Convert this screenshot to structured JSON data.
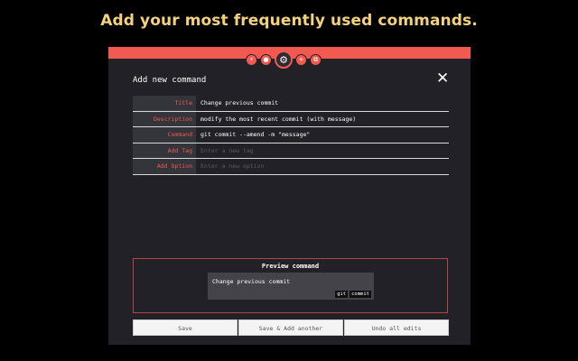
{
  "headline": "Add your most frequently used commands.",
  "colors": {
    "accent": "#f25a51",
    "headline": "#f3d27a",
    "panel": "#212127"
  },
  "nav_icons": [
    "bolt-icon",
    "location-pin-icon",
    "gear-icon",
    "plus-icon",
    "external-link-icon"
  ],
  "panel": {
    "title": "Add new command",
    "close_icon": "close-icon"
  },
  "form": {
    "rows": [
      {
        "label": "Title",
        "value": "Change previous commit",
        "placeholder": ""
      },
      {
        "label": "Description",
        "value": "modify the most recent commit (with message)",
        "placeholder": ""
      },
      {
        "label": "Command",
        "value": "git commit --amend -m \"message\"",
        "placeholder": ""
      },
      {
        "label": "Add Tag",
        "value": "",
        "placeholder": "Enter a new tag"
      },
      {
        "label": "Add Option",
        "value": "",
        "placeholder": "Enter a new option"
      }
    ]
  },
  "preview": {
    "title": "Preview command",
    "card_title": "Change previous commit",
    "tags": [
      "git",
      "commit"
    ]
  },
  "buttons": {
    "save": "Save",
    "save_add": "Save & Add another",
    "undo": "Undo all edits"
  }
}
